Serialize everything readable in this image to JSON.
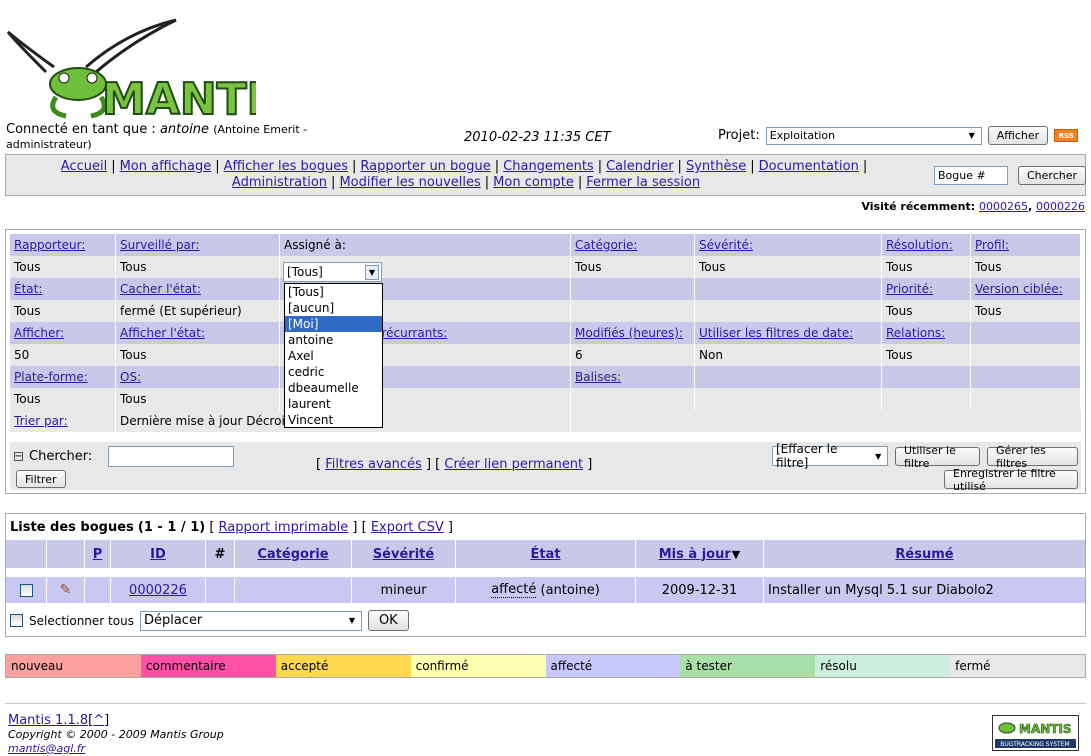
{
  "header": {
    "login_prefix": "Connecté en tant que :",
    "username": "antoine",
    "user_fullname": "(Antoine Emerit - administrateur)",
    "server_time": "2010-02-23 11:35 CET",
    "project_label": "Projet:",
    "project_value": "Exploitation",
    "afficher_button": "Afficher",
    "rss_label": "RSS"
  },
  "menu": {
    "items": [
      "Accueil",
      "Mon affichage",
      "Afficher les bogues",
      "Rapporter un bogue",
      "Changements",
      "Calendrier",
      "Synthèse",
      "Documentation",
      "Administration",
      "Modifier les nouvelles",
      "Mon compte",
      "Fermer la session"
    ],
    "bug_placeholder": "Bogue #",
    "search_button": "Chercher"
  },
  "recent": {
    "label": "Visité récemment:",
    "links": [
      "0000265",
      "0000226"
    ]
  },
  "filters": {
    "row1_heads": [
      "Rapporteur:",
      "Surveillé par:",
      "Assigné à:",
      "",
      "Catégorie:",
      "Sévérité:",
      "Résolution:",
      "Profil:"
    ],
    "row1_vals": [
      "Tous",
      "Tous",
      "",
      "",
      "Tous",
      "Tous",
      "Tous",
      "Tous"
    ],
    "row2_heads": [
      "État:",
      "Cacher l'état:",
      "",
      "",
      "",
      "",
      "Priorité:",
      "Version ciblée:"
    ],
    "row2_vals": [
      "Tous",
      "fermé (Et supérieur)",
      "",
      "",
      "",
      "",
      "Tous",
      "Tous"
    ],
    "row3_heads": [
      "Afficher:",
      "Afficher l'état:",
      "",
      "es récurrants:",
      "Modifiés (heures):",
      "Utiliser les filtres de date:",
      "Relations:",
      ""
    ],
    "row3_vals": [
      "50",
      "Tous",
      "",
      "",
      "6",
      "Non",
      "Tous",
      ""
    ],
    "row4_heads": [
      "Plate-forme:",
      "OS:",
      "",
      "",
      "Balises:",
      "",
      "",
      ""
    ],
    "row4_vals": [
      "Tous",
      "Tous",
      "",
      "",
      "",
      "",
      "",
      ""
    ],
    "sort_label": "Trier par:",
    "sort_value": "Dernière mise à jour Décroissant",
    "search_label": "Chercher:",
    "filter_button": "Filtrer",
    "advanced_link": "Filtres avancés",
    "permalink_link": "Créer lien permanent",
    "reset_select": "[Effacer le filtre]",
    "use_filter_button": "Utiliser le filtre",
    "manage_filters_button": "Gérer les filtres",
    "save_filter_button": "Enregistrer le filtre utilisé"
  },
  "assign_dropdown": {
    "selected": "[Tous]",
    "options": [
      "[Tous]",
      "[aucun]",
      "[Moi]",
      "antoine",
      "Axel",
      "cedric",
      "dbeaumelle",
      "laurent",
      "Vincent"
    ],
    "highlighted": "[Moi]"
  },
  "buglist": {
    "title": "Liste des bogues",
    "count": "(1 - 1 / 1)",
    "print_link": "Rapport imprimable",
    "csv_link": "Export CSV",
    "columns": [
      "",
      "",
      "P",
      "ID",
      "#",
      "Catégorie",
      "Sévérité",
      "État",
      "Mis à jour",
      "Résumé"
    ],
    "row": {
      "id": "0000226",
      "severity": "mineur",
      "status": "affecté",
      "assignee": "(antoine)",
      "updated": "2009-12-31",
      "summary": "Installer un Mysql 5.1 sur Diabolo2"
    },
    "select_all": "Selectionner tous",
    "action_select": "Déplacer",
    "ok_button": "OK"
  },
  "legend": [
    {
      "label": "nouveau",
      "color": "#fca0a0"
    },
    {
      "label": "commentaire",
      "color": "#ff50a8"
    },
    {
      "label": "accepté",
      "color": "#ffd850"
    },
    {
      "label": "confirmé",
      "color": "#ffffb0"
    },
    {
      "label": "affecté",
      "color": "#c8c8ff"
    },
    {
      "label": "à tester",
      "color": "#a8e0a8"
    },
    {
      "label": "résolu",
      "color": "#cceedd"
    },
    {
      "label": "fermé",
      "color": "#e8e8e8"
    }
  ],
  "footer": {
    "version": "Mantis 1.1.8",
    "top_link": "^",
    "copyright": "Copyright © 2000 - 2009 Mantis Group",
    "email": "mantis@agl.fr"
  },
  "logo_text": "MANTIS",
  "badge_text": "BUGTRACKING SYSTEM"
}
